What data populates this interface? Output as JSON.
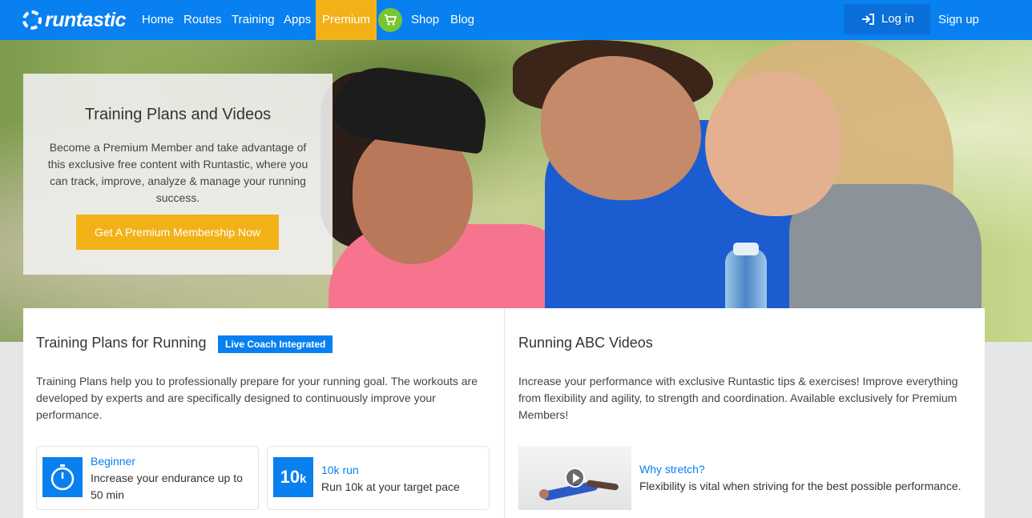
{
  "nav": {
    "logo": "runtastic",
    "links": [
      "Home",
      "Routes",
      "Training",
      "Apps",
      "Premium",
      "Shop",
      "Blog"
    ],
    "login": "Log in",
    "signup": "Sign up",
    "cart_icon": "shopping-cart-icon",
    "login_icon": "sign-in-icon"
  },
  "hero": {
    "title": "Training Plans and Videos",
    "text": "Become a Premium Member and take advantage of this exclusive free content with Runtastic, where you can track, improve, analyze & manage your running success.",
    "button": "Get A Premium Membership Now"
  },
  "training": {
    "title": "Training Plans for Running",
    "badge": "Live Coach Integrated",
    "text": "Training Plans help you to professionally prepare for your running goal. The workouts are developed by experts and are specifically designed to continuously improve your performance.",
    "cards": [
      {
        "title": "Beginner",
        "desc": "Increase your endurance up to 50 min",
        "icon": "stopwatch-icon"
      },
      {
        "title": "10k run",
        "desc": "Run 10k at your target pace",
        "icon_text": "10",
        "icon_sub": "k"
      }
    ]
  },
  "videos": {
    "title": "Running ABC Videos",
    "text": "Increase your performance with exclusive Runtastic tips & exercises! Improve everything from flexibility and agility, to strength and coordination. Available exclusively for Premium Members!",
    "items": [
      {
        "title": "Why stretch?",
        "desc": "Flexibility is vital when striving for the best possible performance."
      }
    ]
  },
  "colors": {
    "brand_blue": "#0880f0",
    "premium_yellow": "#f2b217",
    "cart_green": "#78c531"
  }
}
